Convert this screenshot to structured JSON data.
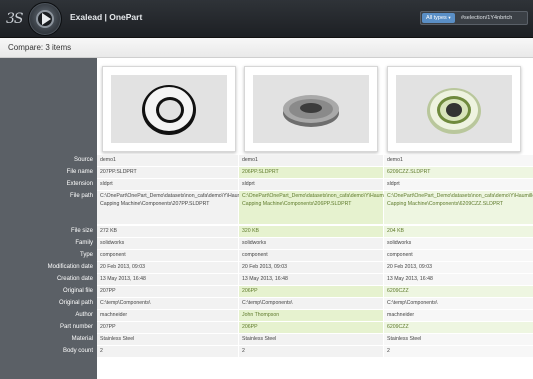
{
  "app": {
    "logo_text": "3S",
    "title": "Exalead | OnePart"
  },
  "search": {
    "type_button": "All types",
    "type_caret": "▾",
    "query": "#selection/1Y4nbrtch"
  },
  "compare": {
    "title": "Compare: 3 items"
  },
  "rows": [
    {
      "label": "Source",
      "values": [
        "demo1",
        "demo1",
        "demo1"
      ],
      "same": [
        false,
        true,
        true
      ]
    },
    {
      "label": "File name",
      "values": [
        "207PP.SLDPRT",
        "206PP.SLDPRT",
        "6209CZZ.SLDPRT"
      ],
      "same": [
        false,
        false,
        false
      ]
    },
    {
      "label": "Extension",
      "values": [
        "sldprt",
        "sldprt",
        "sldprt"
      ],
      "same": [
        false,
        true,
        true
      ]
    },
    {
      "label": "File path",
      "values": [
        "C:\\OnePart\\OnePart_Demo\\datasets\\non_cafa\\demo\\Y\\Haumiller Capping Machine\\Components\\207PP.SLDPRT",
        "C:\\OnePart\\OnePart_Demo\\datasets\\non_cafa\\demo\\Y\\Haumiller Capping Machine\\Components\\206PP.SLDPRT",
        "C:\\OnePart\\OnePart_Demo\\datasets\\non_cafa\\demo\\Y\\Haumiller Capping Machine\\Components\\6209CZZ.SLDPRT"
      ],
      "same": [
        false,
        false,
        false
      ]
    },
    {
      "label": "File size",
      "values": [
        "272 KB",
        "320 KB",
        "204 KB"
      ],
      "same": [
        false,
        false,
        false
      ]
    },
    {
      "label": "Family",
      "values": [
        "solidworks",
        "solidworks",
        "solidworks"
      ],
      "same": [
        false,
        true,
        true
      ]
    },
    {
      "label": "Type",
      "values": [
        "component",
        "component",
        "component"
      ],
      "same": [
        false,
        true,
        true
      ]
    },
    {
      "label": "Modification date",
      "values": [
        "20 Feb 2013, 09:03",
        "20 Feb 2013, 09:03",
        "20 Feb 2013, 09:03"
      ],
      "same": [
        false,
        true,
        true
      ]
    },
    {
      "label": "Creation date",
      "values": [
        "13 May 2013, 16:48",
        "13 May 2013, 16:48",
        "13 May 2013, 16:48"
      ],
      "same": [
        false,
        true,
        true
      ]
    },
    {
      "label": "Original file",
      "values": [
        "207PP",
        "206PP",
        "6209CZZ"
      ],
      "same": [
        false,
        false,
        false
      ]
    },
    {
      "label": "Original path",
      "values": [
        "C:\\temp\\Components\\",
        "C:\\temp\\Components\\",
        "C:\\temp\\Components\\"
      ],
      "same": [
        false,
        true,
        true
      ]
    },
    {
      "label": "Author",
      "values": [
        "machneider",
        "John Thompson",
        "machneider"
      ],
      "same": [
        false,
        false,
        true
      ]
    },
    {
      "label": "Part number",
      "values": [
        "207PP",
        "206PP",
        "6209CZZ"
      ],
      "same": [
        false,
        false,
        false
      ]
    },
    {
      "label": "Material",
      "values": [
        "Stainless Steel",
        "Stainless Steel",
        "Stainless Steel"
      ],
      "same": [
        false,
        true,
        true
      ]
    },
    {
      "label": "Body count",
      "values": [
        "2",
        "2",
        "2"
      ],
      "same": [
        false,
        true,
        true
      ]
    }
  ],
  "items": [
    {
      "name": "207PP",
      "thumbnail_icon": "bearing-ring-white-icon"
    },
    {
      "name": "206PP",
      "thumbnail_icon": "bearing-ring-grey-icon"
    },
    {
      "name": "6209CZZ",
      "thumbnail_icon": "bearing-ring-green-icon"
    }
  ],
  "colors": {
    "topbar": "#23272b",
    "label_column": "#5b6066",
    "diff_highlight": "#e6f2cf",
    "diff_text": "#5e7a2b",
    "accent": "#5a8fc6"
  }
}
